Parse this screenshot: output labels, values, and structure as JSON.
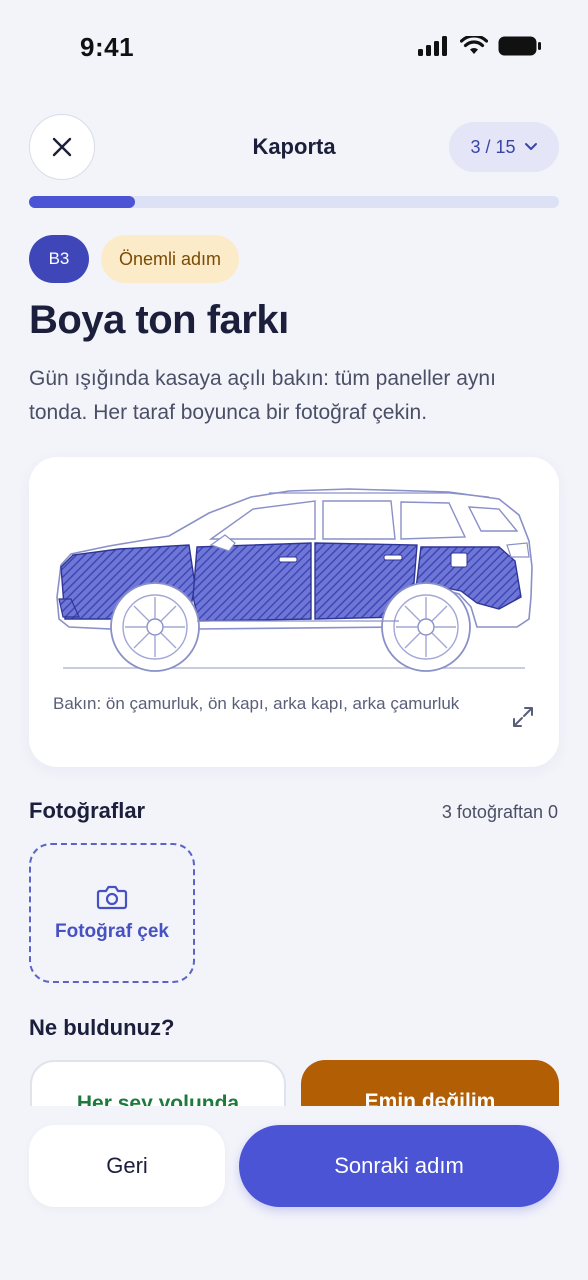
{
  "status_bar": {
    "time": "9:41"
  },
  "header": {
    "title": "Kaporta",
    "step_indicator": "3 / 15"
  },
  "progress": {
    "current_step": 3,
    "total_steps": 15,
    "fraction": 0.2
  },
  "step": {
    "code": "B3",
    "priority": "Önemli adım",
    "title": "Boya ton farkı",
    "description": "Gün ışığında kasaya açılı bakın: tüm paneller aynı tonda. Her taraf boyunca bir fotoğraf çekin."
  },
  "diagram": {
    "caption": "Bakın: ön çamurluk, ön kapı, arka kapı, arka çamurluk",
    "highlight_color": "#3F47B8"
  },
  "photos": {
    "label": "Fotoğraflar",
    "count": "3 fotoğraftan 0",
    "take_photo_label": "Fotoğraf çek"
  },
  "question": {
    "label": "Ne buldunuz?",
    "answers": [
      {
        "label": "Her şey yolunda"
      },
      {
        "label": "Emin değilim"
      }
    ]
  },
  "footer": {
    "back_label": "Geri",
    "next_label": "Sonraki adım"
  },
  "colors": {
    "accent": "#4A54D4",
    "ok_text": "#1E7A3C",
    "unsure_bg": "#B25E05",
    "priority_bg": "#FCEBC8"
  }
}
